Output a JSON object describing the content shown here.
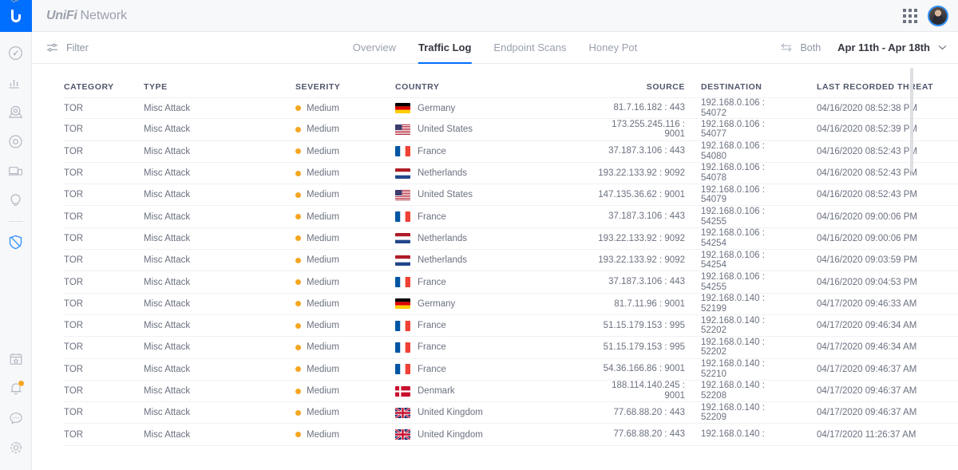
{
  "brand": {
    "unifi": "UniFi",
    "network": "Network"
  },
  "topbar": {
    "apps_icon": "grid-apps-icon",
    "avatar": "user-avatar"
  },
  "rail": {
    "logo": "ubiquiti-logo",
    "items": [
      {
        "name": "dashboard-icon",
        "icon": "speedometer"
      },
      {
        "name": "statistics-icon",
        "icon": "bar-chart"
      },
      {
        "name": "topology-icon",
        "icon": "map-pin"
      },
      {
        "name": "devices-icon",
        "icon": "circle-target"
      },
      {
        "name": "clients-icon",
        "icon": "laptop-phone"
      },
      {
        "name": "insights-icon",
        "icon": "lightbulb"
      },
      {
        "name": "threat-management-icon",
        "icon": "shield",
        "active": true
      }
    ],
    "bottom_items": [
      {
        "name": "events-calendar-icon",
        "icon": "calendar-star"
      },
      {
        "name": "alerts-icon",
        "icon": "bell",
        "badge": true
      },
      {
        "name": "chat-icon",
        "icon": "chat-bubble"
      },
      {
        "name": "settings-icon",
        "icon": "gear"
      }
    ]
  },
  "subbar": {
    "filter_label": "Filter",
    "filter_icon": "filter-sliders-icon",
    "both_label": "Both",
    "both_icon": "swap-arrows-icon",
    "date_range": "Apr 11th - Apr 18th",
    "chevron_icon": "chevron-down-icon",
    "tabs": [
      {
        "label": "Overview",
        "active": false
      },
      {
        "label": "Traffic Log",
        "active": true
      },
      {
        "label": "Endpoint Scans",
        "active": false
      },
      {
        "label": "Honey Pot",
        "active": false
      }
    ]
  },
  "table": {
    "columns": [
      "CATEGORY",
      "TYPE",
      "SEVERITY",
      "COUNTRY",
      "SOURCE",
      "DESTINATION",
      "LAST RECORDED THREAT"
    ],
    "accent_severity_color": "#f5a623",
    "rows": [
      {
        "category": "TOR",
        "type": "Misc Attack",
        "severity": "Medium",
        "country": "Germany",
        "flag": "de",
        "source_ip": "81.7.16.182 : 443",
        "source_ip2": "",
        "dest_ip": "192.168.0.106 :",
        "dest_port": "54072",
        "threat": "04/16/2020 08:52:38 PM"
      },
      {
        "category": "TOR",
        "type": "Misc Attack",
        "severity": "Medium",
        "country": "United States",
        "flag": "us",
        "source_ip": "173.255.245.116 :",
        "source_ip2": "9001",
        "dest_ip": "192.168.0.106 :",
        "dest_port": "54077",
        "threat": "04/16/2020 08:52:39 PM"
      },
      {
        "category": "TOR",
        "type": "Misc Attack",
        "severity": "Medium",
        "country": "France",
        "flag": "fr",
        "source_ip": "37.187.3.106 : 443",
        "source_ip2": "",
        "dest_ip": "192.168.0.106 :",
        "dest_port": "54080",
        "threat": "04/16/2020 08:52:43 PM"
      },
      {
        "category": "TOR",
        "type": "Misc Attack",
        "severity": "Medium",
        "country": "Netherlands",
        "flag": "nl",
        "source_ip": "193.22.133.92 : 9092",
        "source_ip2": "",
        "dest_ip": "192.168.0.106 :",
        "dest_port": "54078",
        "threat": "04/16/2020 08:52:43 PM"
      },
      {
        "category": "TOR",
        "type": "Misc Attack",
        "severity": "Medium",
        "country": "United States",
        "flag": "us",
        "source_ip": "147.135.36.62 : 9001",
        "source_ip2": "",
        "dest_ip": "192.168.0.106 :",
        "dest_port": "54079",
        "threat": "04/16/2020 08:52:43 PM"
      },
      {
        "category": "TOR",
        "type": "Misc Attack",
        "severity": "Medium",
        "country": "France",
        "flag": "fr",
        "source_ip": "37.187.3.106 : 443",
        "source_ip2": "",
        "dest_ip": "192.168.0.106 :",
        "dest_port": "54255",
        "threat": "04/16/2020 09:00:06 PM"
      },
      {
        "category": "TOR",
        "type": "Misc Attack",
        "severity": "Medium",
        "country": "Netherlands",
        "flag": "nl",
        "source_ip": "193.22.133.92 : 9092",
        "source_ip2": "",
        "dest_ip": "192.168.0.106 :",
        "dest_port": "54254",
        "threat": "04/16/2020 09:00:06 PM"
      },
      {
        "category": "TOR",
        "type": "Misc Attack",
        "severity": "Medium",
        "country": "Netherlands",
        "flag": "nl",
        "source_ip": "193.22.133.92 : 9092",
        "source_ip2": "",
        "dest_ip": "192.168.0.106 :",
        "dest_port": "54254",
        "threat": "04/16/2020 09:03:59 PM"
      },
      {
        "category": "TOR",
        "type": "Misc Attack",
        "severity": "Medium",
        "country": "France",
        "flag": "fr",
        "source_ip": "37.187.3.106 : 443",
        "source_ip2": "",
        "dest_ip": "192.168.0.106 :",
        "dest_port": "54255",
        "threat": "04/16/2020 09:04:53 PM"
      },
      {
        "category": "TOR",
        "type": "Misc Attack",
        "severity": "Medium",
        "country": "Germany",
        "flag": "de",
        "source_ip": "81.7.11.96 : 9001",
        "source_ip2": "",
        "dest_ip": "192.168.0.140 :",
        "dest_port": "52199",
        "threat": "04/17/2020 09:46:33 AM"
      },
      {
        "category": "TOR",
        "type": "Misc Attack",
        "severity": "Medium",
        "country": "France",
        "flag": "fr",
        "source_ip": "51.15.179.153 : 995",
        "source_ip2": "",
        "dest_ip": "192.168.0.140 :",
        "dest_port": "52202",
        "threat": "04/17/2020 09:46:34 AM"
      },
      {
        "category": "TOR",
        "type": "Misc Attack",
        "severity": "Medium",
        "country": "France",
        "flag": "fr",
        "source_ip": "51.15.179.153 : 995",
        "source_ip2": "",
        "dest_ip": "192.168.0.140 :",
        "dest_port": "52202",
        "threat": "04/17/2020 09:46:34 AM"
      },
      {
        "category": "TOR",
        "type": "Misc Attack",
        "severity": "Medium",
        "country": "France",
        "flag": "fr",
        "source_ip": "54.36.166.86 : 9001",
        "source_ip2": "",
        "dest_ip": "192.168.0.140 :",
        "dest_port": "52210",
        "threat": "04/17/2020 09:46:37 AM"
      },
      {
        "category": "TOR",
        "type": "Misc Attack",
        "severity": "Medium",
        "country": "Denmark",
        "flag": "dk",
        "source_ip": "188.114.140.245 :",
        "source_ip2": "9001",
        "dest_ip": "192.168.0.140 :",
        "dest_port": "52208",
        "threat": "04/17/2020 09:46:37 AM"
      },
      {
        "category": "TOR",
        "type": "Misc Attack",
        "severity": "Medium",
        "country": "United Kingdom",
        "flag": "gb",
        "source_ip": "77.68.88.20 : 443",
        "source_ip2": "",
        "dest_ip": "192.168.0.140 :",
        "dest_port": "52209",
        "threat": "04/17/2020 09:46:37 AM"
      },
      {
        "category": "TOR",
        "type": "Misc Attack",
        "severity": "Medium",
        "country": "United Kingdom",
        "flag": "gb",
        "source_ip": "77.68.88.20 : 443",
        "source_ip2": "",
        "dest_ip": "192.168.0.140 :",
        "dest_port": "",
        "threat": "04/17/2020 11:26:37 AM"
      }
    ]
  }
}
